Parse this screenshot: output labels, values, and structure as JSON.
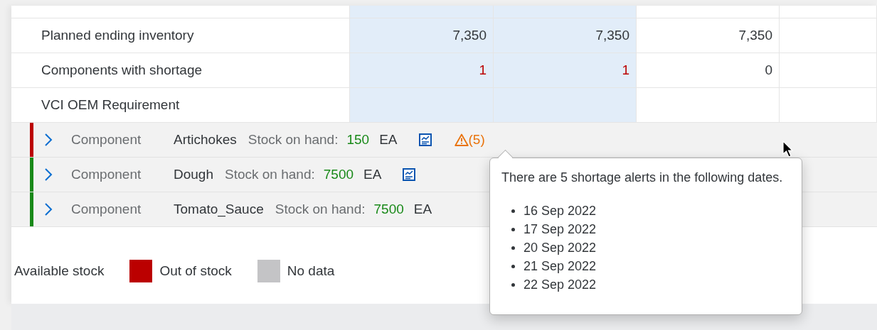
{
  "table": {
    "columns": [
      {
        "highlighted": true
      },
      {
        "highlighted": true
      },
      {
        "highlighted": false
      },
      {
        "highlighted": false
      }
    ],
    "rows": [
      {
        "label": "Planned ending inventory",
        "cells": [
          {
            "text": "7,350",
            "alert": false
          },
          {
            "text": "7,350",
            "alert": false
          },
          {
            "text": "7,350",
            "alert": false
          }
        ]
      },
      {
        "label": "Components with shortage",
        "cells": [
          {
            "text": "1",
            "alert": true
          },
          {
            "text": "1",
            "alert": true
          },
          {
            "text": "0",
            "alert": false
          }
        ]
      },
      {
        "label": "VCI OEM Requirement",
        "cells": []
      }
    ]
  },
  "components": [
    {
      "type_label": "Component",
      "name": "Artichokes",
      "stock_label": "Stock on hand:",
      "stock": "150",
      "unit": "EA",
      "color": "#bb0000",
      "report_icon": true,
      "alert_count": "(5)"
    },
    {
      "type_label": "Component",
      "name": "Dough",
      "stock_label": "Stock on hand:",
      "stock": "7500",
      "unit": "EA",
      "color": "#188918",
      "report_icon": true
    },
    {
      "type_label": "Component",
      "name": "Tomato_Sauce",
      "stock_label": "Stock on hand:",
      "stock": "7500",
      "unit": "EA",
      "color": "#188918",
      "report_icon": false
    }
  ],
  "legend": {
    "title": "Available stock",
    "items": [
      {
        "label": "Out of stock",
        "color": "#bb0000"
      },
      {
        "label": "No data",
        "color": "#c4c4c6"
      }
    ]
  },
  "popover": {
    "message": "There are 5 shortage alerts in the following dates.",
    "dates": [
      "16 Sep 2022",
      "17 Sep 2022",
      "20 Sep 2022",
      "21 Sep 2022",
      "22 Sep 2022"
    ]
  }
}
